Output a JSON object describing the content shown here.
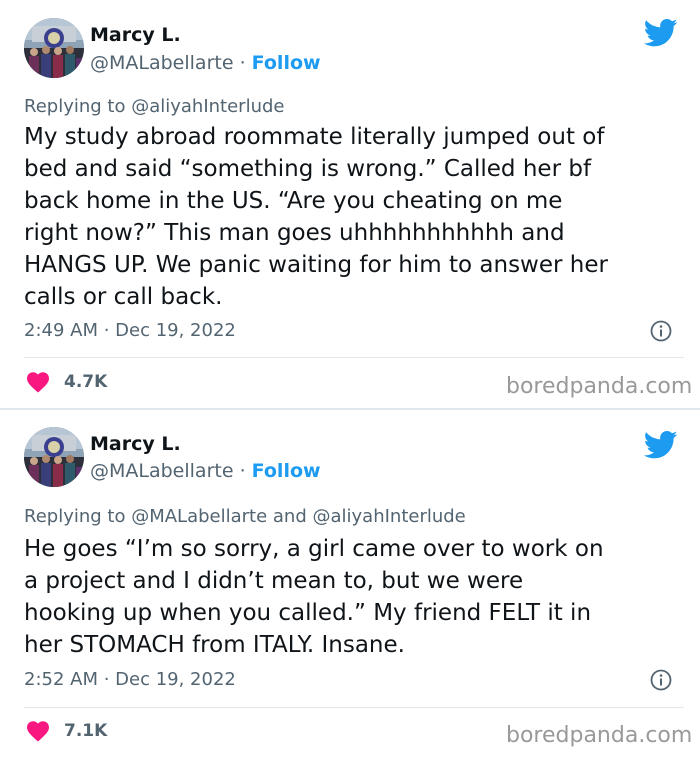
{
  "colors": {
    "twitter_blue": "#1d9bf0",
    "heart": "#f91880",
    "secondary_text": "#536471",
    "watermark": "#999999"
  },
  "tweets": [
    {
      "author_name": "Marcy L.",
      "handle": "@MALabellarte",
      "dot": "·",
      "follow_label": "Follow",
      "replying_to": "Replying to @aliyahInterlude",
      "text": "My study abroad roommate literally jumped out of\nbed and said “something is wrong.” Called her bf\nback home in the US. “Are you cheating on me\nright now?” This man goes uhhhhhhhhhhh and\nHANGS UP. We panic waiting for him to answer her\ncalls or call back.",
      "timestamp": "2:49 AM · Dec 19, 2022",
      "likes": "4.7K",
      "watermark": "boredpanda.com",
      "icons": [
        "avatar-photo",
        "twitter-bird-icon",
        "info-icon",
        "heart-icon"
      ]
    },
    {
      "author_name": "Marcy L.",
      "handle": "@MALabellarte",
      "dot": "·",
      "follow_label": "Follow",
      "replying_to": "Replying to @MALabellarte and @aliyahInterlude",
      "text": "He goes “I’m so sorry, a girl came over to work on\na project and I didn’t mean to, but we were\nhooking up when you called.” My friend FELT it in\nher STOMACH from ITALY. Insane.",
      "timestamp": "2:52 AM · Dec 19, 2022",
      "likes": "7.1K",
      "watermark": "boredpanda.com",
      "icons": [
        "avatar-photo",
        "twitter-bird-icon",
        "info-icon",
        "heart-icon"
      ]
    }
  ]
}
